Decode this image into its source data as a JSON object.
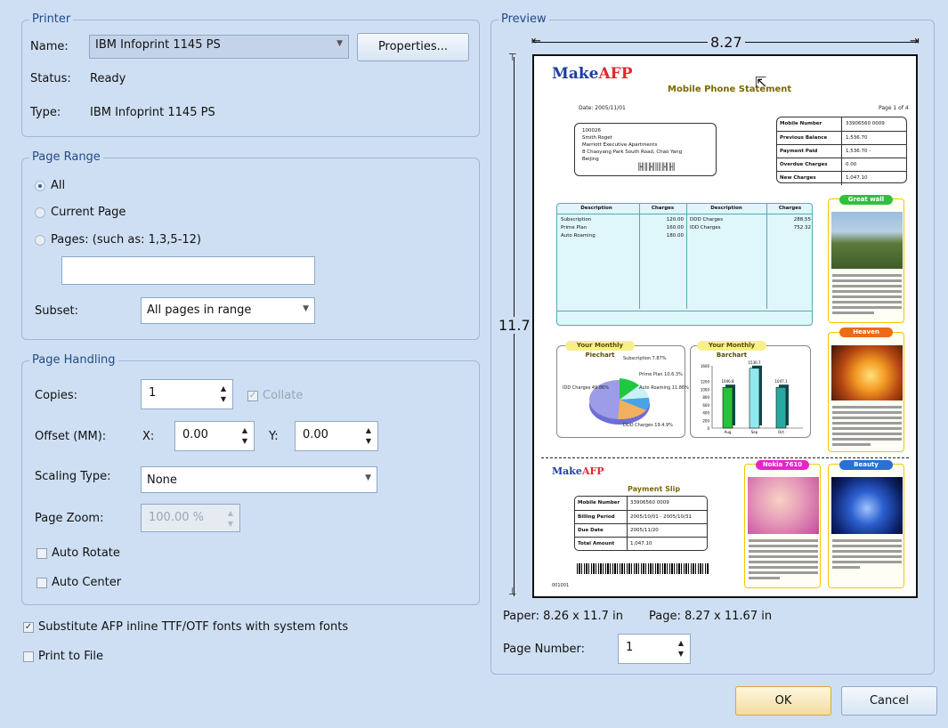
{
  "printer": {
    "title": "Printer",
    "name_label": "Name:",
    "name_value": "IBM Infoprint 1145 PS",
    "properties_label": "Properties...",
    "status_label": "Status:",
    "status_value": "Ready",
    "type_label": "Type:",
    "type_value": "IBM Infoprint 1145 PS"
  },
  "page_range": {
    "title": "Page Range",
    "all_label": "All",
    "current_label": "Current Page",
    "pages_label": "Pages: (such as: 1,3,5-12)",
    "pages_value": "",
    "selected": "All",
    "subset_label": "Subset:",
    "subset_value": "All pages in range"
  },
  "page_handling": {
    "title": "Page Handling",
    "copies_label": "Copies:",
    "copies_value": "1",
    "collate_label": "Collate",
    "offset_label": "Offset (MM):",
    "x_label": "X:",
    "x_value": "0.00",
    "y_label": "Y:",
    "y_value": "0.00",
    "scaling_label": "Scaling Type:",
    "scaling_value": "None",
    "zoom_label": "Page Zoom:",
    "zoom_value": "100.00 %",
    "auto_rotate_label": "Auto Rotate",
    "auto_center_label": "Auto Center"
  },
  "options": {
    "substitute_label": "Substitute AFP inline TTF/OTF fonts with system fonts",
    "substitute_checked": true,
    "print_to_file_label": "Print to File",
    "print_to_file_checked": false
  },
  "preview": {
    "title": "Preview",
    "width_label": "8.27",
    "height_label": "11.7",
    "paper_info": "Paper: 8.26 x 11.7 in",
    "page_info": "Page: 8.27 x 11.67 in",
    "page_number_label": "Page Number:",
    "page_number_value": "1",
    "doc": {
      "logo_make": "Make",
      "logo_afp": "AFP",
      "title": "Mobile Phone Statement",
      "date": "Date: 2005/11/01",
      "page_of": "Page 1 of 4",
      "address": [
        "100026",
        "Smith Roget",
        "Marriott Executive Apartments",
        "8 Chaoyang Park South Road, Chao Yang",
        "Beijing"
      ],
      "summary": [
        {
          "label": "Mobile Number",
          "value": "33906560 0009"
        },
        {
          "label": "Previous Balance",
          "value": "1,536.70"
        },
        {
          "label": "Payment Paid",
          "value": "1,536.70 -"
        },
        {
          "label": "Overdue Charges",
          "value": "0.00"
        },
        {
          "label": "New Charges",
          "value": "1,047.10"
        }
      ],
      "charges_headers": [
        "Description",
        "Charges",
        "Description",
        "Charges"
      ],
      "charges_rows": [
        [
          "Subscription",
          "120.00",
          "DDD Charges",
          "288.55"
        ],
        [
          "Prime Plan",
          "160.00",
          "IDD Charges",
          "752.32"
        ],
        [
          "Auto Roaming",
          "180.00",
          "",
          ""
        ]
      ],
      "pie_title": "Your Monthly Piechart",
      "pie_labels": [
        "Subscription 7.87%",
        "Prime Plan 10.6.3%",
        "Auto Roaming 11.86%",
        "IDD Charges 49.86%",
        "DDD Charges 19.4.9%"
      ],
      "bar_title": "Your Monthly Barchart",
      "bar_values": [
        "1046.8",
        "1536.7",
        "1047.1"
      ],
      "bar_cats": [
        "Aug",
        "Sep",
        "Oct"
      ],
      "bar_ticks": [
        "1600",
        "1200",
        "1000",
        "800",
        "600",
        "400",
        "200",
        "0"
      ],
      "greatwall_label": "Great wall",
      "greatwall_text": "Splendid landscape, a venerated history, and a rich cultural legacy have added to the fascination of China as a major travelers' dream destination. The Great Wall is one of the largest building construction projects ever completed.",
      "heaven_label": "Heaven",
      "heaven_text": "The bird wishes it were a cloud. The cloud wishes it were a bird. The trees, like the longings of the earth, stand a tiptoe to peep at the heaven.",
      "slip_title": "Payment Slip",
      "slip_rows": [
        {
          "label": "Mobile Number",
          "value": "33906560 0009"
        },
        {
          "label": "Billing Period",
          "value": "2005/10/01 - 2005/10/31"
        },
        {
          "label": "Due Date",
          "value": "2005/11/20"
        },
        {
          "label": "Total Amount",
          "value": "1,047.10"
        }
      ],
      "slip_code": "001001",
      "nokia_label": "Nokia 7610",
      "nokia_text": "Your megapixel camera for quality printing. Up to 10 minutes video recording. Movie Director application for automated video production. 8 MB internal dynamic memory with 64 MB Reduced Size MultiMediaCard (MMC). Mobile links with Series 60 software on the Symbian operating system.",
      "beauty_label": "Beauty",
      "beauty_text": "Being simple can be deeply satisfying. The beauty of simplicity is in the art of keeping things clear and harmonious."
    }
  },
  "buttons": {
    "ok": "OK",
    "cancel": "Cancel"
  },
  "colors": {
    "background": "#cfdff3",
    "group_border": "#9fb7d6",
    "group_title": "#1e4b86",
    "selected_combo": "#c5d3ea",
    "charges_table": "#dff6fb",
    "photo_border": "#f0c800",
    "pill_greatwall": "#2fc13b",
    "pill_heaven": "#ee6a17",
    "pill_nokia": "#e824c7",
    "pill_beauty": "#2b6fd6",
    "logo_make": "#1c3ea0",
    "logo_afp": "#e4262b"
  }
}
